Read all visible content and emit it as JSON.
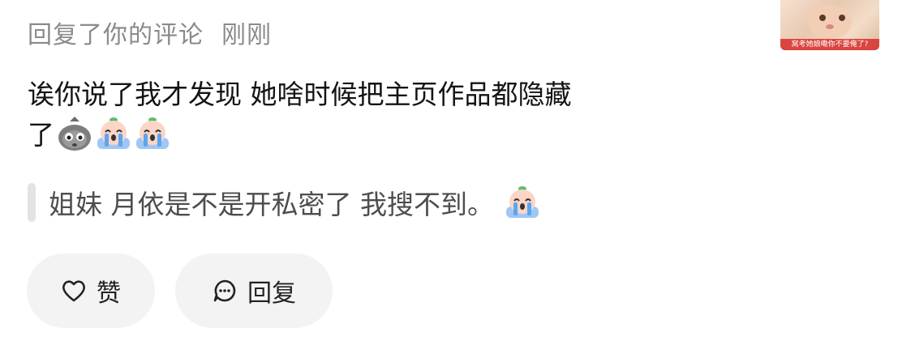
{
  "header": {
    "action_text": "回复了你的评论",
    "time": "刚刚"
  },
  "thumbnail": {
    "caption": "窝考她娘嘞你不要俺了?"
  },
  "comment": {
    "line1": "诶你说了我才发现 她啥时候把主页作品都隐藏",
    "line2": "了"
  },
  "quote": {
    "text": "姐妹 月依是不是开私密了 我搜不到。"
  },
  "actions": {
    "like_label": "赞",
    "reply_label": "回复"
  },
  "colors": {
    "muted_text": "#8a8a8a",
    "button_bg": "#f3f3f3",
    "quote_bar": "#e3e3e3"
  },
  "icons": [
    "heart-icon",
    "comment-bubble-icon",
    "stone-face-emoji",
    "crying-peach-emoji"
  ]
}
